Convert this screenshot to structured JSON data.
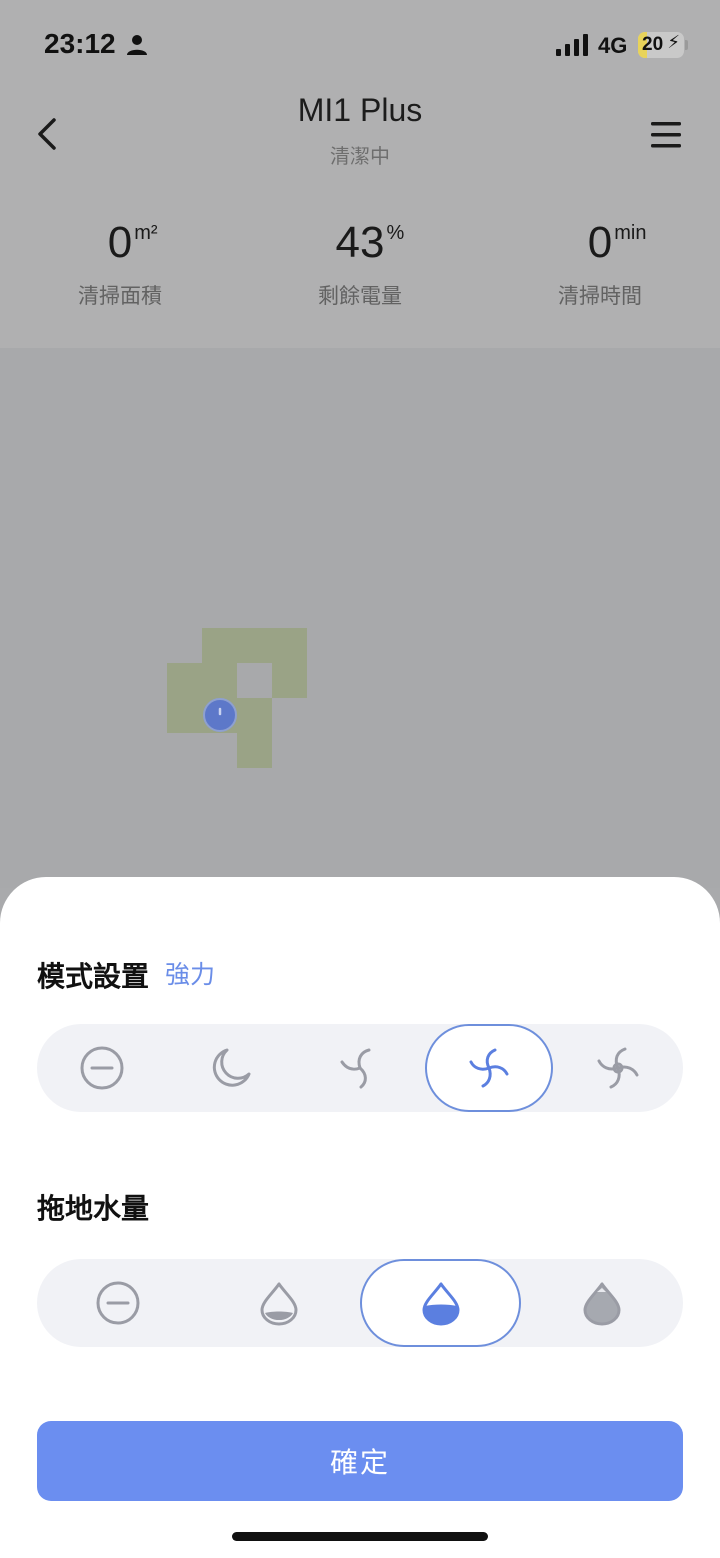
{
  "status_bar": {
    "time": "23:12",
    "network": "4G",
    "battery": "20",
    "battery_level": 0.2
  },
  "header": {
    "title": "MI1 Plus",
    "subtitle": "清潔中"
  },
  "stats": [
    {
      "value": "0",
      "unit": "m²",
      "label": "清掃面積"
    },
    {
      "value": "43",
      "unit": "%",
      "label": "剩餘電量"
    },
    {
      "value": "0",
      "unit": "min",
      "label": "清掃時間"
    }
  ],
  "mode": {
    "title": "模式設置",
    "current": "強力",
    "options": [
      "off-icon",
      "quiet-moon-icon",
      "fan-standard-icon",
      "fan-strong-icon",
      "fan-max-icon"
    ],
    "selected_index": 3
  },
  "water": {
    "title": "拖地水量",
    "options": [
      "off-icon",
      "drop-low-icon",
      "drop-medium-icon",
      "drop-high-icon"
    ],
    "selected_index": 2
  },
  "confirm_label": "確定",
  "colors": {
    "accent": "#6b8ef0",
    "map_area": "#9aa386",
    "robot": "#5d78c9"
  }
}
